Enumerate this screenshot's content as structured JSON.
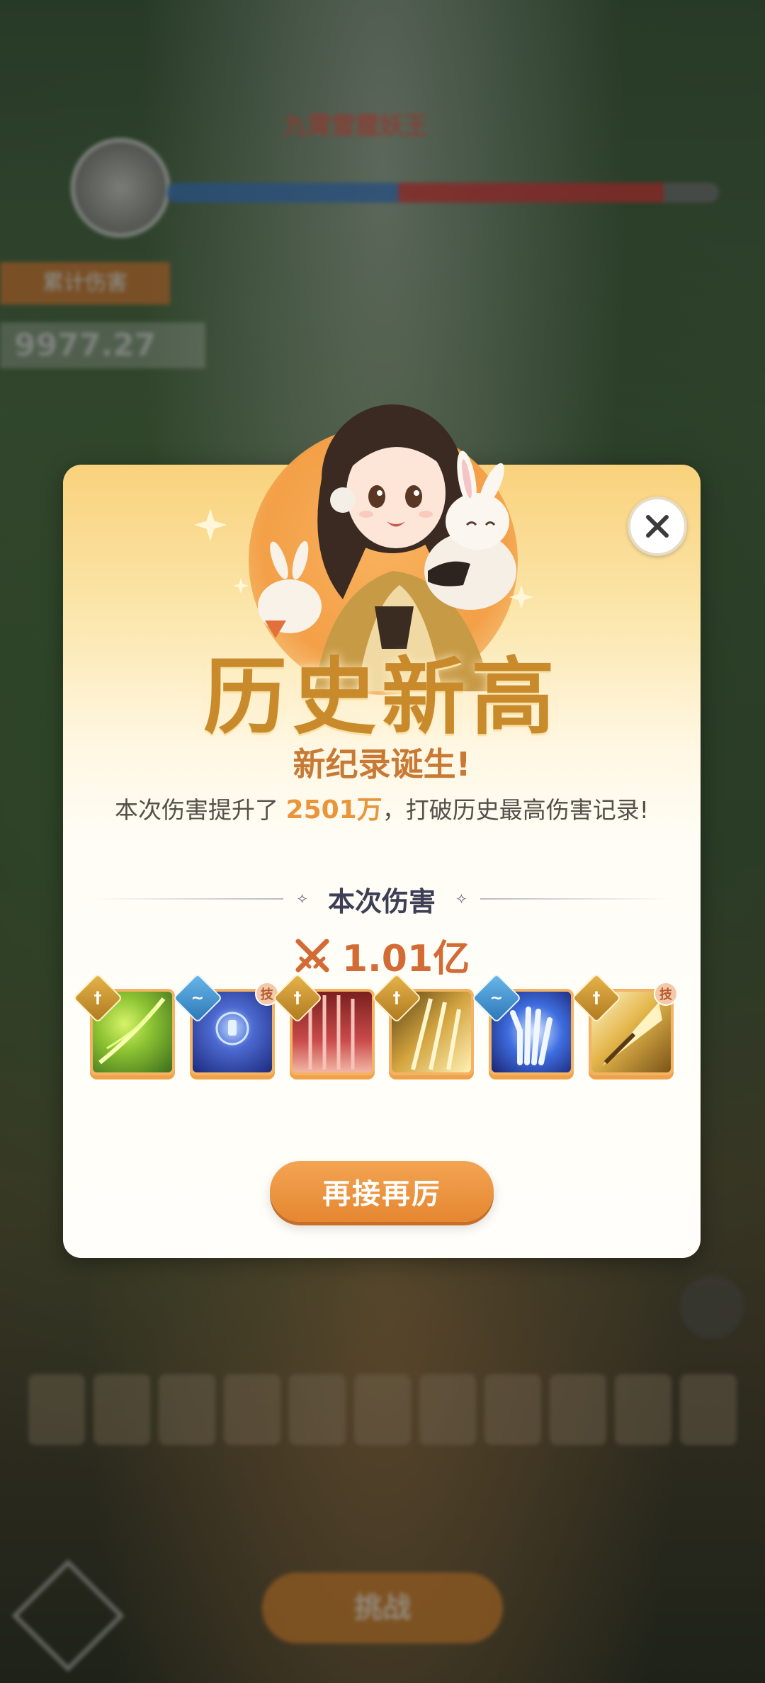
{
  "background": {
    "boss_name": "九霄雷霆妖王",
    "damage_tag": "累计伤害",
    "total_damage": "9977.27",
    "bottom_button_label": "挑战"
  },
  "dialog": {
    "headline": "历史新高",
    "subheadline": "新纪录诞生!",
    "description": {
      "prefix": "本次伤害提升了",
      "amount": "2501万",
      "suffix": "，打破历史最高伤害记录!"
    },
    "section_title": "本次伤害",
    "damage_value": "1.01亿",
    "skills": [
      {
        "name": "skill-wind-slash",
        "element": "sword",
        "tag": ""
      },
      {
        "name": "skill-arcane-orb",
        "element": "water",
        "tag": "技"
      },
      {
        "name": "skill-crimson-blades",
        "element": "sword",
        "tag": ""
      },
      {
        "name": "skill-golden-swords",
        "element": "sword",
        "tag": ""
      },
      {
        "name": "skill-thunder-palm",
        "element": "water",
        "tag": ""
      },
      {
        "name": "skill-golden-spear",
        "element": "sword",
        "tag": "技"
      }
    ],
    "cta_label": "再接再厉"
  },
  "colors": {
    "accent_orange": "#e9953a",
    "headline_gold": "#c98a2c",
    "cta": "#e58731"
  }
}
